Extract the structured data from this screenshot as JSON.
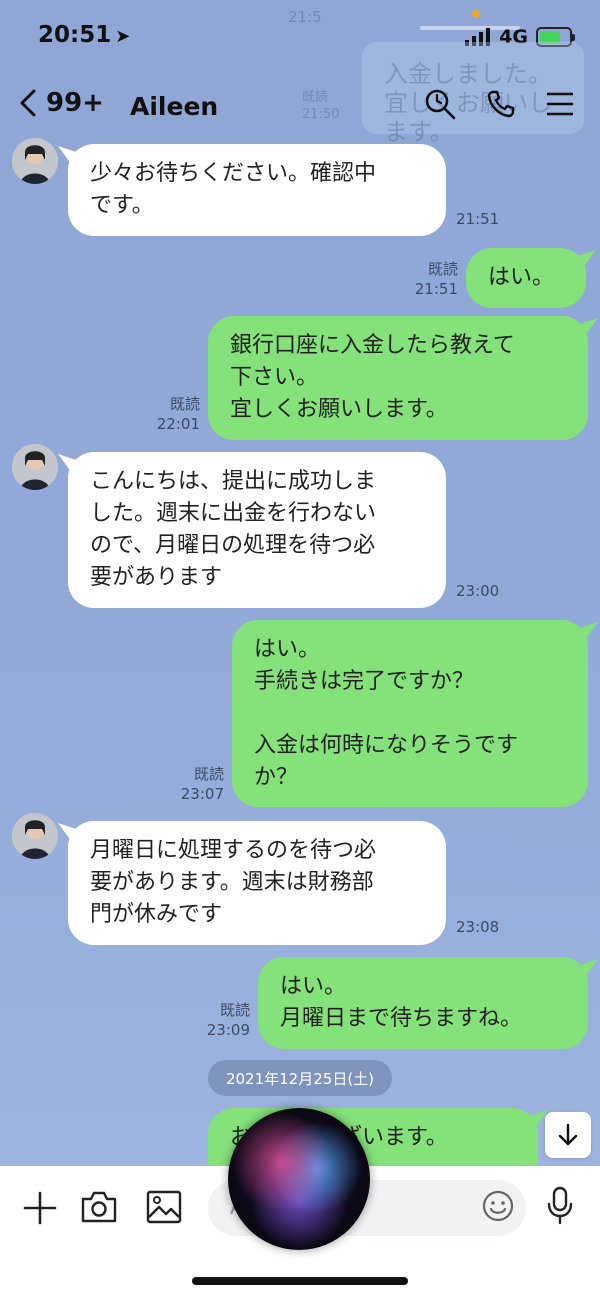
{
  "status": {
    "time": "20:51",
    "network": "4G"
  },
  "header": {
    "back_count": "99+",
    "title": "Aileen"
  },
  "ghost": {
    "time": "21:5",
    "read": "既読\n21:50",
    "text": "入金しました。\n宜しくお願いします。"
  },
  "messages": [
    {
      "side": "left",
      "text": "少々お待ちください。確認中\nです。",
      "time": "21:51"
    },
    {
      "side": "right",
      "text": "はい。",
      "read": "既読",
      "time": "21:51"
    },
    {
      "side": "right",
      "text": "銀行口座に入金したら教えて\n下さい。\n宜しくお願いします。",
      "read": "既読",
      "time": "22:01"
    },
    {
      "side": "left",
      "text": "こんにちは、提出に成功しま\nした。週末に出金を行わない\nので、月曜日の処理を待つ必\n要があります",
      "time": "23:00"
    },
    {
      "side": "right",
      "text": "はい。\n手続きは完了ですか？\n\n入金は何時になりそうです\nか？",
      "read": "既読",
      "time": "23:07"
    },
    {
      "side": "left",
      "text": "月曜日に処理するのを待つ必\n要があります。週末は財務部\n門が休みです",
      "time": "23:08"
    },
    {
      "side": "right",
      "text": "はい。\n月曜日まで待ちますね。",
      "read": "既読",
      "time": "23:09"
    },
    {
      "side": "right",
      "text": "おはようございます。"
    }
  ],
  "date_divider": "2021年12月25日(土)",
  "input": {
    "placeholder": "Aa"
  },
  "colors": {
    "background": "#92a9d8",
    "own_bubble": "#85e17a",
    "other_bubble": "#ffffff"
  },
  "icons": [
    "chevron-left-icon",
    "search-icon",
    "phone-icon",
    "menu-icon",
    "plus-icon",
    "camera-icon",
    "image-icon",
    "emoji-icon",
    "mic-icon",
    "arrow-down-icon"
  ]
}
